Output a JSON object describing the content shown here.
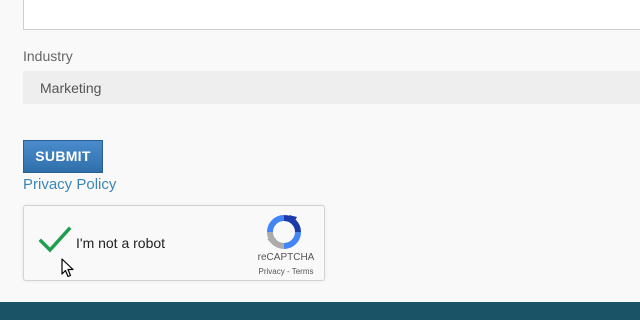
{
  "form": {
    "industry_label": "Industry",
    "industry_value": "Marketing",
    "submit_label": "SUBMIT",
    "privacy_link": "Privacy Policy"
  },
  "recaptcha": {
    "checkbox_label": "I'm not a robot",
    "checked": true,
    "brand": "reCAPTCHA",
    "terms": "Privacy - Terms"
  },
  "colors": {
    "submit_button": "#3a7dbf",
    "link": "#3c86b7",
    "check": "#1e9e4f",
    "footer": "#1b5366"
  },
  "icons": {
    "checkbox": "checkmark-icon",
    "logo": "recaptcha-logo-icon",
    "cursor": "mouse-pointer-icon"
  }
}
